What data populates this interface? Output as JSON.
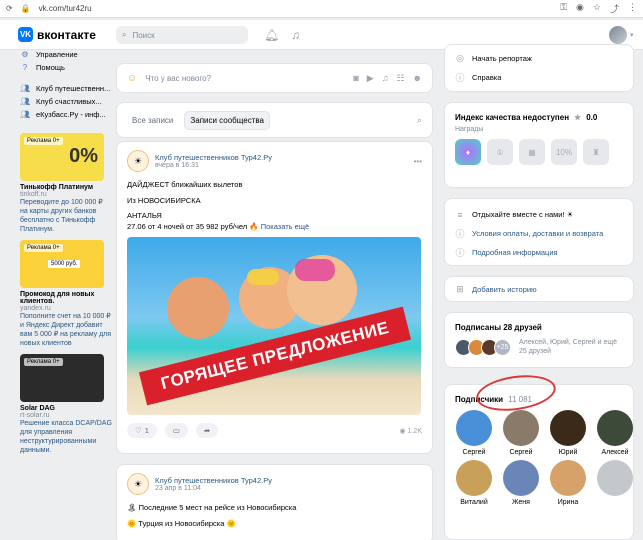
{
  "browser": {
    "url": "vk.com/tur42ru"
  },
  "header": {
    "logo_text": "вконтакте",
    "logo_mark": "VK",
    "search_placeholder": "Поиск"
  },
  "left_menu": [
    {
      "label": "Управление",
      "icon": "gear-icon"
    },
    {
      "label": "Помощь",
      "icon": "help-icon"
    },
    {
      "label": "Клуб путешественн...",
      "icon": "users-icon"
    },
    {
      "label": "Клуб счастливых...",
      "icon": "users-icon"
    },
    {
      "label": "еКузбасс.Ру - инф...",
      "icon": "users-icon"
    }
  ],
  "ads": [
    {
      "tag": "Реклама 0+",
      "title": "Тинькофф Платинум",
      "domain": "tinkoff.ru",
      "text": "Переводите до 100 000 ₽ на карты других банков бесплатно с Тинькофф Платинум.",
      "color": "#f7dd4a"
    },
    {
      "tag": "Реклама 0+",
      "title": "Промокод для новых клиентов.",
      "domain": "yandex.ru",
      "text": "Пополните счет на 10 000 ₽ и Яндекс Директ добавит вам 5 000 ₽ на рекламу для новых клиентов",
      "color": "#fbd13a",
      "promo": "5000 руб."
    },
    {
      "tag": "Реклама 0+",
      "title": "Solar DAG",
      "domain": "rt-solar.ru",
      "text": "Решение класса DCAP/DAG для управления неструктурированными данными.",
      "color": "#2b2b2b"
    }
  ],
  "composer": {
    "placeholder": "Что у вас нового?"
  },
  "feed_tabs": [
    {
      "label": "Все записи",
      "active": false
    },
    {
      "label": "Записи сообщества",
      "active": true
    }
  ],
  "post1": {
    "author": "Клуб путешественников Тур42.Ру",
    "time": "вчера в 16:31",
    "lines": [
      "ДАЙДЖЕСТ ближайших вылетов",
      "Из НОВОСИБИРСКА",
      "АНТАЛЬЯ"
    ],
    "offer": "27.06 от 4 ночей от 35 982 руб/чел 🔥",
    "more": "Показать ещё",
    "banner": "ГОРЯЩЕЕ ПРЕДЛОЖЕНИЕ",
    "likes": "1",
    "views": "1.2K"
  },
  "post2": {
    "author": "Клуб путешественников Тур42.Ру",
    "time": "23 апр в 11:04",
    "line1": "🏝 Последние 5 мест на рейсе из Новосибирска",
    "line2": "🌞 Турция из Новосибирска 🌞"
  },
  "right_top": [
    {
      "label": "Начать репортаж",
      "icon": "broadcast-icon"
    },
    {
      "label": "Справка",
      "icon": "info-icon"
    }
  ],
  "quality": {
    "title": "Индекс качества недоступен",
    "score": "0.0",
    "awards_label": "Награды",
    "badge_pct": "10%"
  },
  "info_links": [
    {
      "label": "Отдыхайте вместе с нами! ☀",
      "icon": "menu-icon",
      "link": false
    },
    {
      "label": "Условия оплаты, доставки и возврата",
      "icon": "info-icon",
      "link": true
    },
    {
      "label": "Подробная информация",
      "icon": "info-icon",
      "link": true
    }
  ],
  "add_story": "Добавить историю",
  "friends": {
    "title": "Подписаны 28 друзей",
    "more_count": "+25",
    "names": "Алексей, Юрий, Сергей и ещё 25 друзей"
  },
  "subscribers": {
    "title": "Подписчики",
    "count": "11 081",
    "people": [
      {
        "name": "Сергей",
        "color": "#4a90d9"
      },
      {
        "name": "Сергей",
        "color": "#8a7a6a"
      },
      {
        "name": "Юрий",
        "color": "#3b2a1a"
      },
      {
        "name": "Алексей",
        "color": "#3d4a3a"
      },
      {
        "name": "Виталий",
        "color": "#c9a05a"
      },
      {
        "name": "Женя",
        "color": "#6a86b8"
      },
      {
        "name": "Ирина",
        "color": "#d7a26a"
      },
      {
        "name": "",
        "color": "#c4c8cc"
      }
    ]
  }
}
